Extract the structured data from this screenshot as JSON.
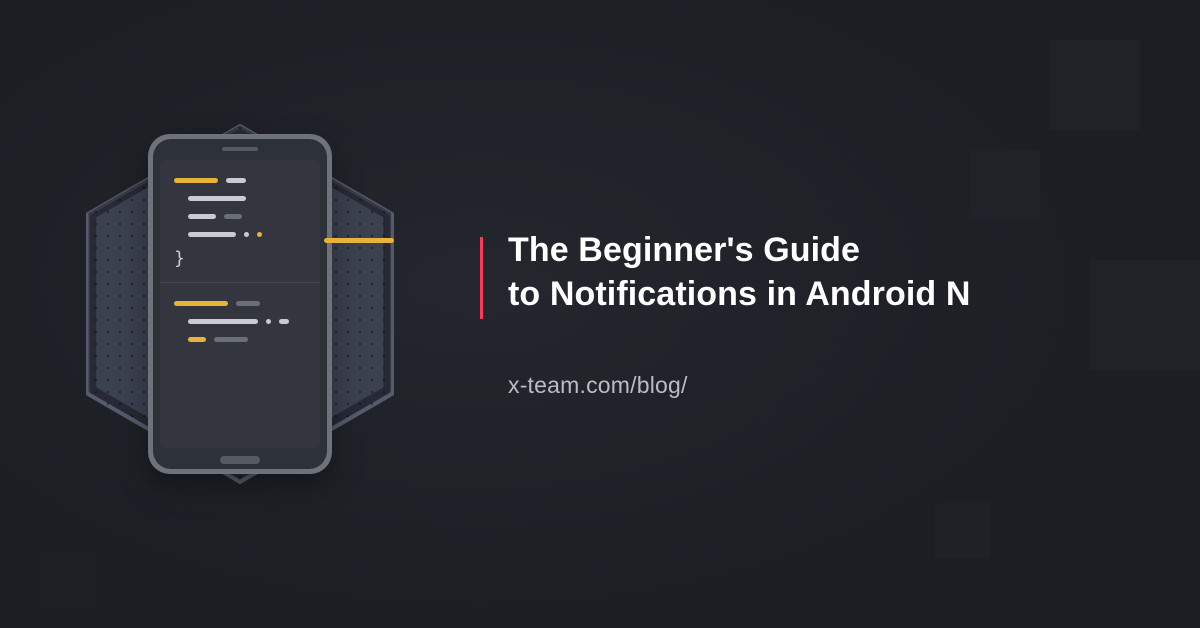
{
  "title_line1": "The Beginner's Guide",
  "title_line2": "to Notifications in Android N",
  "url": "x-team.com/blog/",
  "colors": {
    "accent": "#ff3a56",
    "code_highlight": "#e8b33a",
    "background": "#1c1e24"
  }
}
